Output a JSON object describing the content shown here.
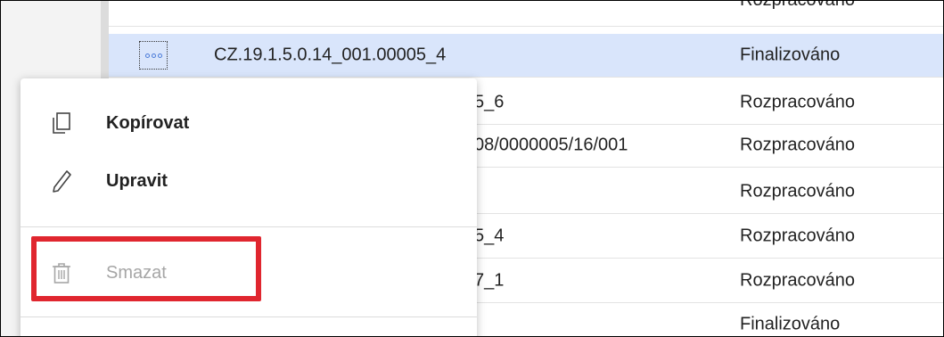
{
  "table": {
    "rows": [
      {
        "code": "",
        "status": "Rozpracováno",
        "selected": false
      },
      {
        "code": "CZ.19.1.5.0.14_001.00005_4",
        "status": "Finalizováno",
        "selected": true
      },
      {
        "code": "5_6",
        "status": "Rozpracováno",
        "selected": false
      },
      {
        "code": "08/0000005/16/001",
        "status": "Rozpracováno",
        "selected": false
      },
      {
        "code": "",
        "status": "Rozpracováno",
        "selected": false
      },
      {
        "code": "5_4",
        "status": "Rozpracováno",
        "selected": false
      },
      {
        "code": "7_1",
        "status": "Rozpracováno",
        "selected": false
      },
      {
        "code": "",
        "status": "Finalizováno",
        "selected": false
      }
    ]
  },
  "menu": {
    "copy_label": "Kopírovat",
    "edit_label": "Upravit",
    "delete_label": "Smazat"
  },
  "colors": {
    "selected_row": "#d9e5fb",
    "highlight_border": "#e0262f",
    "accent_dots": "#4a7bd8",
    "disabled_text": "#a6a6a6"
  },
  "icons": {
    "copy": "copy-icon",
    "edit": "pencil-icon",
    "delete": "trash-icon",
    "row_actions": "more-dots-icon"
  }
}
